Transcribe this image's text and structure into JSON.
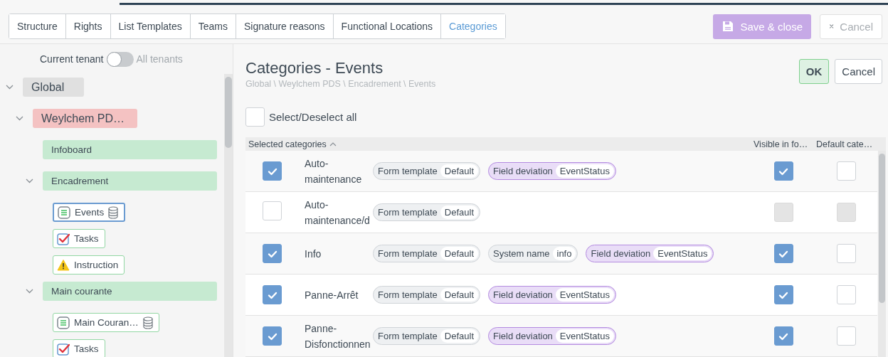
{
  "top_tabs": [
    {
      "label": "Structure",
      "selected": false
    },
    {
      "label": "Rights",
      "selected": false
    },
    {
      "label": "List Templates",
      "selected": false
    },
    {
      "label": "Teams",
      "selected": false
    },
    {
      "label": "Signature reasons",
      "selected": false
    },
    {
      "label": "Functional Locations",
      "selected": false
    },
    {
      "label": "Categories",
      "selected": true
    }
  ],
  "actions": [
    {
      "kind": "save",
      "label": "Save & close"
    },
    {
      "kind": "cancel",
      "label": "Cancel"
    }
  ],
  "tenant_toggle": {
    "left_label": "Current tenant",
    "right_label": "All tenants",
    "on": false
  },
  "tree": [
    {
      "label": "Global",
      "kind": "global",
      "expanded": true,
      "children": [
        {
          "label": "Weylchem PD…",
          "kind": "tenant",
          "expanded": true,
          "children": [
            {
              "label": "Infoboard",
              "kind": "group"
            },
            {
              "label": "Encadrement",
              "kind": "group",
              "expanded": true,
              "children": [
                {
                  "label": "Events",
                  "kind": "list",
                  "database": true,
                  "selected": true
                },
                {
                  "label": "Tasks",
                  "kind": "tasks",
                  "database": false,
                  "selected": false
                },
                {
                  "label": "Instruction",
                  "kind": "instruction",
                  "database": false,
                  "selected": false
                }
              ]
            },
            {
              "label": "Main courante",
              "kind": "group",
              "expanded": true,
              "children": [
                {
                  "label": "Main Couran…",
                  "kind": "list",
                  "database": true,
                  "selected": false
                },
                {
                  "label": "Tasks",
                  "kind": "tasks",
                  "database": false,
                  "selected": false
                }
              ]
            }
          ]
        }
      ]
    }
  ],
  "panel": {
    "title": "Categories - Events",
    "breadcrumb": "Global \\ Weylchem PDS \\ Encadrement \\ Events",
    "buttons": [
      {
        "kind": "ok",
        "label": "OK"
      },
      {
        "kind": "cancel",
        "label": "Cancel"
      }
    ],
    "select_all": {
      "label": "Select/Deselect all",
      "checked": false
    }
  },
  "table": {
    "columns": [
      {
        "label": "Selected categories",
        "sorted": true
      },
      {
        "label": "Visible in fo…"
      },
      {
        "label": "Default cate…"
      }
    ],
    "rows": [
      {
        "checked": true,
        "name": "Auto-maintenance",
        "tags": [
          {
            "kind": "form",
            "label": "Form template",
            "value": "Default"
          },
          {
            "kind": "deviation",
            "label": "Field deviation",
            "value": "EventStatus"
          }
        ],
        "visible": {
          "checked": true,
          "disabled": false
        },
        "default": {
          "checked": false,
          "disabled": false
        }
      },
      {
        "checked": false,
        "name": "Auto-maintenance/d",
        "tags": [
          {
            "kind": "form",
            "label": "Form template",
            "value": "Default"
          }
        ],
        "visible": {
          "checked": false,
          "disabled": true
        },
        "default": {
          "checked": false,
          "disabled": true
        }
      },
      {
        "checked": true,
        "name": "Info",
        "tags": [
          {
            "kind": "form",
            "label": "Form template",
            "value": "Default"
          },
          {
            "kind": "system",
            "label": "System name",
            "value": "info"
          },
          {
            "kind": "deviation",
            "label": "Field deviation",
            "value": "EventStatus"
          }
        ],
        "visible": {
          "checked": true,
          "disabled": false
        },
        "default": {
          "checked": false,
          "disabled": false
        }
      },
      {
        "checked": true,
        "name": "Panne-Arrêt",
        "tags": [
          {
            "kind": "form",
            "label": "Form template",
            "value": "Default"
          },
          {
            "kind": "deviation",
            "label": "Field deviation",
            "value": "EventStatus"
          }
        ],
        "visible": {
          "checked": true,
          "disabled": false
        },
        "default": {
          "checked": false,
          "disabled": false
        }
      },
      {
        "checked": true,
        "name": "Panne-Disfonctionnen",
        "tags": [
          {
            "kind": "form",
            "label": "Form template",
            "value": "Default"
          },
          {
            "kind": "deviation",
            "label": "Field deviation",
            "value": "EventStatus"
          }
        ],
        "visible": {
          "checked": true,
          "disabled": false
        },
        "default": {
          "checked": false,
          "disabled": false
        }
      }
    ]
  }
}
